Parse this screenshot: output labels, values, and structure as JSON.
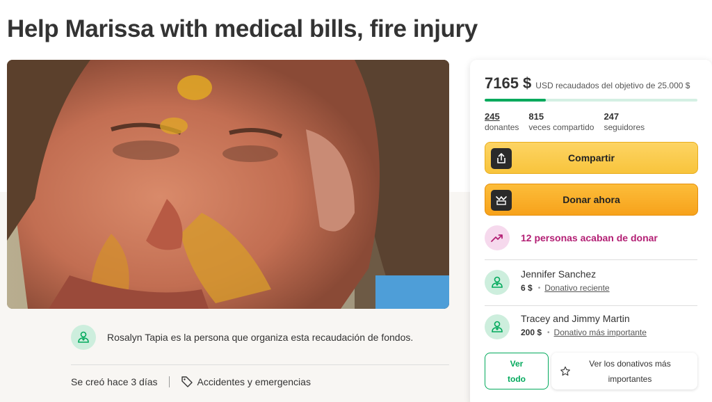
{
  "page": {
    "title": "Help Marissa with medical bills, fire injury"
  },
  "photo": {
    "icon": "campaign-photo"
  },
  "organizer": {
    "text": "Rosalyn Tapia es la persona que organiza esta recaudación de fondos.",
    "icon": "user-heart-icon"
  },
  "meta": {
    "created": "Se creó hace 3 días",
    "category": "Accidentes y emergencias",
    "category_icon": "tag-icon"
  },
  "donation_panel": {
    "raised_amount": "7165 $",
    "goal_text": "USD recaudados del objetivo de 25.000 $",
    "progress_fraction": 0.2866,
    "colors": {
      "progress": "#02a95c",
      "progress_track": "#d4f0e3",
      "trend": "#b31f74",
      "share": "#f8c43c",
      "donate": "#f7a21b"
    },
    "stats": [
      {
        "num": "245",
        "label": "donantes"
      },
      {
        "num": "815",
        "label": "veces compartido"
      },
      {
        "num": "247",
        "label": "seguidores"
      }
    ],
    "share_label": "Compartir",
    "donate_label": "Donar ahora",
    "trending_text": "12 personas acaban de donar",
    "donors": [
      {
        "name": "Jennifer Sanchez",
        "amount": "6 $",
        "tag": "Donativo reciente"
      },
      {
        "name": "Tracey and Jimmy Martin",
        "amount": "200 $",
        "tag": "Donativo más importante"
      }
    ],
    "see_all_line1": "Ver",
    "see_all_line2": "todo",
    "top_donations_line1": "Ver los donativos más",
    "top_donations_line2": "importantes"
  }
}
